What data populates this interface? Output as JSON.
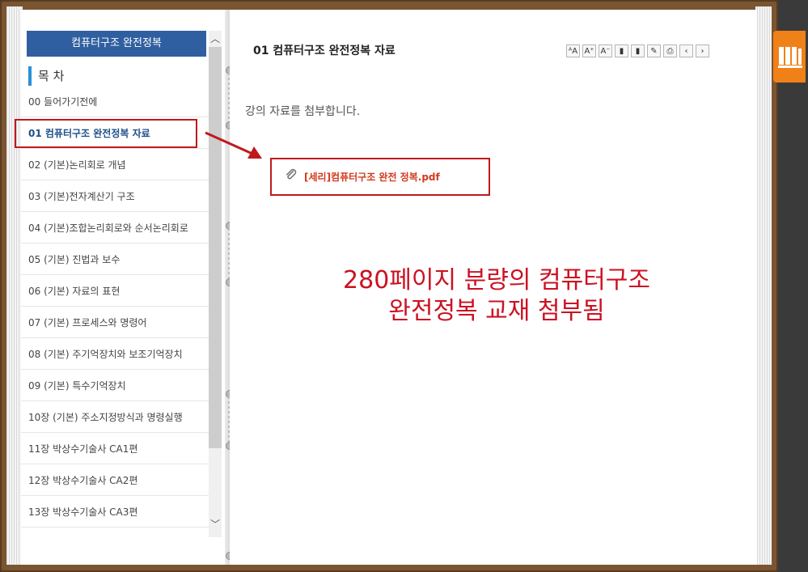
{
  "sidebar": {
    "header": "컴퓨터구조 완전정복",
    "toc_title": "목 차",
    "items": [
      {
        "label": "00 들어가기전에"
      },
      {
        "label": "01 컴퓨터구조 완전정복 자료",
        "active": true
      },
      {
        "label": "02 (기본)논리회로 개념"
      },
      {
        "label": "03 (기본)전자계산기 구조"
      },
      {
        "label": "04 (기본)조합논리회로와 순서논리회로"
      },
      {
        "label": "05 (기본) 진법과 보수"
      },
      {
        "label": "06 (기본) 자료의 표현"
      },
      {
        "label": "07 (기본) 프로세스와 명령어"
      },
      {
        "label": "08 (기본) 주기억장치와 보조기억장치"
      },
      {
        "label": "09 (기본) 특수기억장치"
      },
      {
        "label": "10장 (기본) 주소지정방식과 명령실행"
      },
      {
        "label": "11장 박상수기술사 CA1편"
      },
      {
        "label": "12장 박상수기술사 CA2편"
      },
      {
        "label": "13장 박상수기술사 CA3편"
      }
    ]
  },
  "content": {
    "title": "01 컴퓨터구조 완전정복 자료",
    "intro": "강의 자료를 첨부합니다.",
    "attachment": "[세리]컴퓨터구조 완전 정복.pdf",
    "annotation_line1": "280페이지 분량의 컴퓨터구조",
    "annotation_line2": "완전정복 교재 첨부됨"
  },
  "toolbar": [
    {
      "icon": "font-size-icon",
      "glyph": "ᴬA"
    },
    {
      "icon": "font-increase-icon",
      "glyph": "A⁺"
    },
    {
      "icon": "font-decrease-icon",
      "glyph": "A⁻"
    },
    {
      "icon": "bookmark-icon",
      "glyph": "▮"
    },
    {
      "icon": "bookmark-list-icon",
      "glyph": "▮"
    },
    {
      "icon": "memo-icon",
      "glyph": "✎"
    },
    {
      "icon": "print-icon",
      "glyph": "⎙"
    },
    {
      "icon": "prev-page-icon",
      "glyph": "‹"
    },
    {
      "icon": "next-page-icon",
      "glyph": "›"
    }
  ],
  "colors": {
    "accent": "#2f5fa0",
    "annotation": "#cc1122",
    "link": "#d23a1e",
    "cover": "#7a5532",
    "library_tab": "#f08018"
  }
}
